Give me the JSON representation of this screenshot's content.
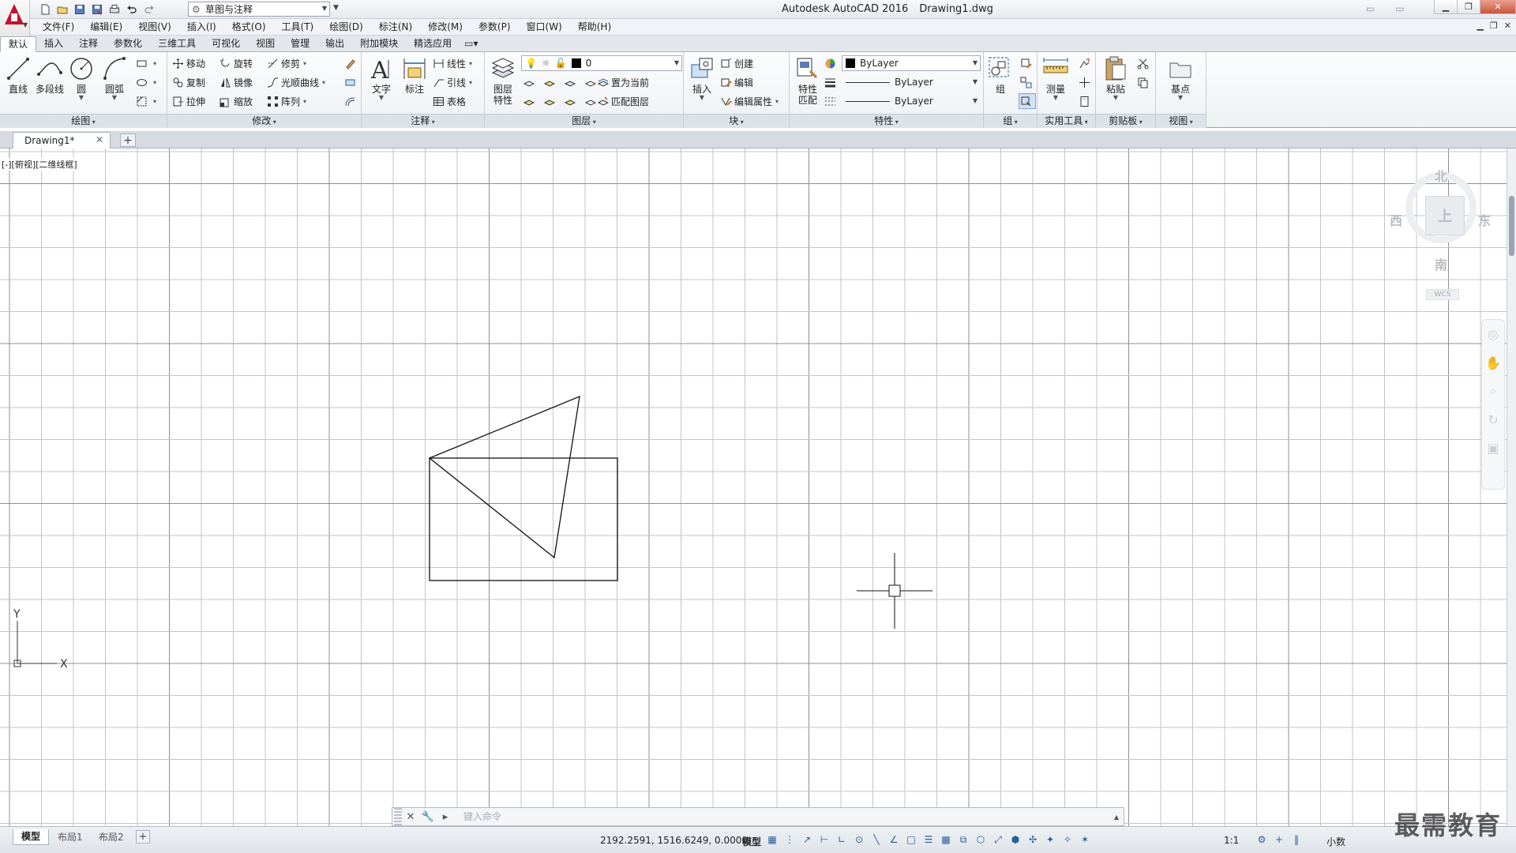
{
  "title": {
    "app": "Autodesk AutoCAD 2016",
    "file": "Drawing1.dwg"
  },
  "workspace": "草图与注释",
  "menu": [
    "文件(F)",
    "编辑(E)",
    "视图(V)",
    "插入(I)",
    "格式(O)",
    "工具(T)",
    "绘图(D)",
    "标注(N)",
    "修改(M)",
    "参数(P)",
    "窗口(W)",
    "帮助(H)"
  ],
  "ribbon_tabs": [
    "默认",
    "插入",
    "注释",
    "参数化",
    "三维工具",
    "可视化",
    "视图",
    "管理",
    "输出",
    "附加模块",
    "精选应用"
  ],
  "panels": {
    "draw": {
      "title": "绘图",
      "line": "直线",
      "polyline": "多段线",
      "circle": "圆",
      "arc": "圆弧"
    },
    "modify": {
      "title": "修改",
      "move": "移动",
      "rotate": "旋转",
      "trim": "修剪",
      "copy": "复制",
      "mirror": "镜像",
      "fillet": "光顺曲线",
      "stretch": "拉伸",
      "scale": "缩放",
      "array": "阵列"
    },
    "annotation": {
      "title": "注释",
      "text": "文字",
      "dimension": "标注",
      "linear": "线性",
      "leader": "引线",
      "table": "表格"
    },
    "layers": {
      "title": "图层",
      "layer_props_1": "图层",
      "layer_props_2": "特性",
      "current_layer": "0",
      "make_current": "置为当前",
      "match_layer": "匹配图层"
    },
    "block": {
      "title": "块",
      "insert": "插入",
      "create": "创建",
      "edit": "编辑",
      "edit_attr": "编辑属性"
    },
    "properties": {
      "title": "特性",
      "match_1": "特性",
      "match_2": "匹配",
      "color": "ByLayer",
      "linetype": "ByLayer",
      "lineweight": "ByLayer"
    },
    "groups": {
      "title": "组",
      "group": "组"
    },
    "utilities": {
      "title": "实用工具",
      "measure": "测量"
    },
    "clipboard": {
      "title": "剪贴板",
      "paste": "粘贴"
    },
    "view": {
      "title": "视图",
      "base": "基点"
    }
  },
  "file_tab": "Drawing1*",
  "viewport_label": "[-][俯视][二维线框]",
  "viewcube": {
    "north": "北",
    "south": "南",
    "east": "东",
    "west": "西",
    "top": "上",
    "wcs": "WCS"
  },
  "command_placeholder": "键入命令",
  "layout_tabs": [
    "模型",
    "布局1",
    "布局2"
  ],
  "status": {
    "coords": "2192.2591, 1516.6249, 0.0000",
    "model": "模型",
    "scale": "1:1",
    "units": "小数"
  },
  "ucs": {
    "x": "X",
    "y": "Y"
  },
  "watermark": "最需教育"
}
